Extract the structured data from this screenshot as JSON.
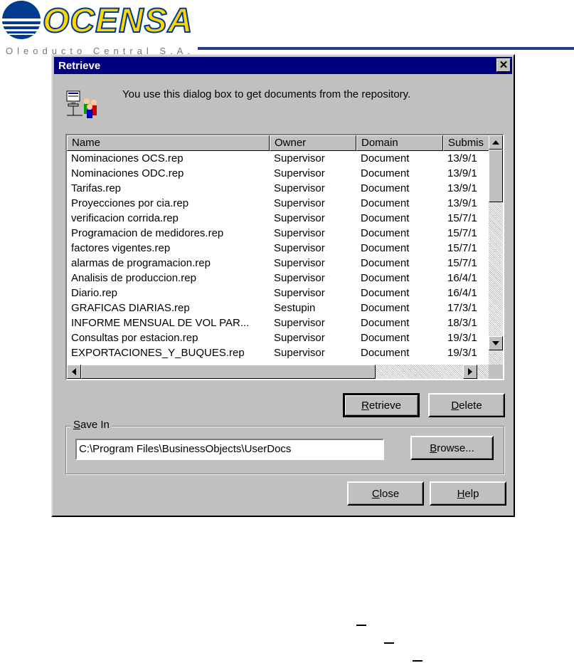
{
  "logo": {
    "brand": "OCENSA",
    "tagline": "Oleoducto Central S.A.",
    "colors": {
      "blue": "#003b8e",
      "yellow": "#ffd700"
    }
  },
  "dialog": {
    "title": "Retrieve",
    "close_symbol": "✕",
    "info_text": "You use this dialog box to get documents from the repository.",
    "columns": [
      "Name",
      "Owner",
      "Domain",
      "Submis"
    ],
    "rows": [
      [
        "Nominaciones OCS.rep",
        "Supervisor",
        "Document",
        "13/9/1"
      ],
      [
        "Nominaciones ODC.rep",
        "Supervisor",
        "Document",
        "13/9/1"
      ],
      [
        "Tarifas.rep",
        "Supervisor",
        "Document",
        "13/9/1"
      ],
      [
        "Proyecciones por cia.rep",
        "Supervisor",
        "Document",
        "13/9/1"
      ],
      [
        "verificacion corrida.rep",
        "Supervisor",
        "Document",
        "15/7/1"
      ],
      [
        "Programacion de medidores.rep",
        "Supervisor",
        "Document",
        "15/7/1"
      ],
      [
        "factores vigentes.rep",
        "Supervisor",
        "Document",
        "15/7/1"
      ],
      [
        "alarmas de programacion.rep",
        "Supervisor",
        "Document",
        "15/7/1"
      ],
      [
        "Analisis de produccion.rep",
        "Supervisor",
        "Document",
        "16/4/1"
      ],
      [
        "Diario.rep",
        "Supervisor",
        "Document",
        "16/4/1"
      ],
      [
        "GRAFICAS DIARIAS.rep",
        "Sestupin",
        "Document",
        "17/3/1"
      ],
      [
        "INFORME MENSUAL DE VOL PAR...",
        "Supervisor",
        "Document",
        "18/3/1"
      ],
      [
        "Consultas por estacion.rep",
        "Supervisor",
        "Document",
        "19/3/1"
      ],
      [
        "EXPORTACIONES_Y_BUQUES.rep",
        "Supervisor",
        "Document",
        "19/3/1"
      ]
    ],
    "buttons": {
      "retrieve": {
        "accel": "R",
        "rest": "etrieve"
      },
      "delete": {
        "accel": "D",
        "rest": "elete"
      },
      "browse": {
        "accel": "B",
        "rest": "rowse..."
      },
      "close": {
        "accel": "C",
        "rest": "lose"
      },
      "help": {
        "accel": "H",
        "rest": "elp"
      }
    },
    "save_in": {
      "label_accel": "S",
      "label_rest": "ave In",
      "path": "C:\\Program Files\\BusinessObjects\\UserDocs"
    }
  }
}
